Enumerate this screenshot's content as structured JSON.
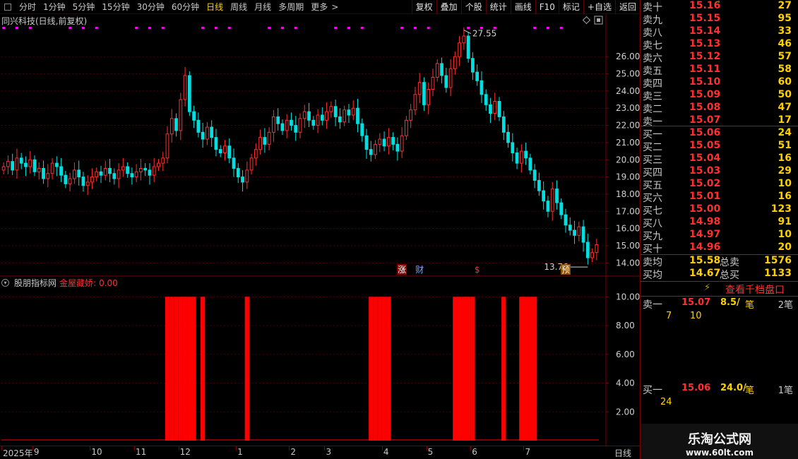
{
  "toolbar": {
    "periods": [
      "分时",
      "1分钟",
      "5分钟",
      "15分钟",
      "30分钟",
      "60分钟",
      "日线",
      "周线",
      "月线",
      "多周期",
      "更多"
    ],
    "active_period": "日线",
    "more_chevron": ">",
    "buttons": [
      "复权",
      "叠加",
      "个股",
      "统计",
      "画线",
      "F10",
      "标记",
      "+自选",
      "返回"
    ]
  },
  "main_chart": {
    "title": "同兴科技(日线,前复权)",
    "high_marker": "27.55",
    "low_marker": "13.76",
    "event_marks": [
      {
        "text": "涨",
        "bg": "#8a0000",
        "fg": "#ffffff",
        "x_day": 90
      },
      {
        "text": "财",
        "bg": "#000000",
        "fg": "#7aa6ff",
        "x_day": 94
      },
      {
        "text": "$",
        "bg": "#000000",
        "fg": "#ff3030",
        "x_day": 107
      },
      {
        "text": "预",
        "bg": "#8a5000",
        "fg": "#ffffff",
        "x_day": 127
      }
    ]
  },
  "indicator": {
    "name": "股朋指标网",
    "line_label": "金屋藏娇:",
    "line_value": "0.00"
  },
  "date_axis": {
    "labels": [
      {
        "text": "2025年",
        "day": 0
      },
      {
        "text": "9",
        "day": 7
      },
      {
        "text": "10",
        "day": 20
      },
      {
        "text": "11",
        "day": 30
      },
      {
        "text": "12",
        "day": 40
      },
      {
        "text": "1",
        "day": 53
      },
      {
        "text": "2",
        "day": 65
      },
      {
        "text": "3",
        "day": 73
      },
      {
        "text": "4",
        "day": 86
      },
      {
        "text": "5",
        "day": 96
      },
      {
        "text": "6",
        "day": 106
      },
      {
        "text": "7",
        "day": 118
      }
    ],
    "period_label": "日线"
  },
  "order_book": {
    "asks": [
      {
        "label": "卖十",
        "price": "15.16",
        "vol": "27",
        "mark": "*"
      },
      {
        "label": "卖九",
        "price": "15.15",
        "vol": "95",
        "mark": ""
      },
      {
        "label": "卖八",
        "price": "15.14",
        "vol": "33",
        "mark": ""
      },
      {
        "label": "卖七",
        "price": "15.13",
        "vol": "46",
        "mark": ""
      },
      {
        "label": "卖六",
        "price": "15.12",
        "vol": "57",
        "mark": ""
      },
      {
        "label": "卖五",
        "price": "15.11",
        "vol": "58",
        "mark": ""
      },
      {
        "label": "卖四",
        "price": "15.10",
        "vol": "60",
        "mark": ""
      },
      {
        "label": "卖三",
        "price": "15.09",
        "vol": "50",
        "mark": ""
      },
      {
        "label": "卖二",
        "price": "15.08",
        "vol": "47",
        "mark": ""
      },
      {
        "label": "卖一",
        "price": "15.07",
        "vol": "17",
        "mark": ""
      }
    ],
    "bids": [
      {
        "label": "买一",
        "price": "15.06",
        "vol": "24",
        "mark": ""
      },
      {
        "label": "买二",
        "price": "15.05",
        "vol": "51",
        "mark": ""
      },
      {
        "label": "买三",
        "price": "15.04",
        "vol": "16",
        "mark": ""
      },
      {
        "label": "买四",
        "price": "15.03",
        "vol": "29",
        "mark": ""
      },
      {
        "label": "买五",
        "price": "15.02",
        "vol": "10",
        "mark": ""
      },
      {
        "label": "买六",
        "price": "15.01",
        "vol": "16",
        "mark": ""
      },
      {
        "label": "买七",
        "price": "15.00",
        "vol": "123",
        "mark": ""
      },
      {
        "label": "买八",
        "price": "14.98",
        "vol": "91",
        "mark": ""
      },
      {
        "label": "买九",
        "price": "14.97",
        "vol": "10",
        "mark": ""
      },
      {
        "label": "买十",
        "price": "14.96",
        "vol": "20",
        "mark": "*"
      }
    ],
    "ask_avg_label": "卖均",
    "ask_avg": "15.58",
    "ask_total_label": "总卖",
    "ask_total": "1576",
    "bid_avg_label": "买均",
    "bid_avg": "14.67",
    "bid_total_label": "总买",
    "bid_total": "1133",
    "depth_button": "查看千档盘口",
    "ask1_tick": {
      "label": "卖一",
      "price": "15.07",
      "per": "8.5/",
      "unit": "笔",
      "count": "2笔",
      "q1": "7",
      "q2": "10"
    },
    "bid1_tick": {
      "label": "买一",
      "price": "15.06",
      "per": "24.0/",
      "unit": "笔",
      "count": "1笔",
      "q1": "24"
    }
  },
  "brand": {
    "name": "乐淘公式网",
    "url": "www.60lt.com"
  },
  "colors": {
    "up": "#ff3030",
    "down": "#00e0e0",
    "grid": "#7a0000",
    "signal": "#ff0000",
    "marker": "#ff00ff"
  },
  "chart_data": {
    "type": "candlestick",
    "title": "同兴科技(日线,前复权)",
    "y_ticks": [
      14,
      15,
      16,
      17,
      18,
      19,
      20,
      21,
      22,
      23,
      24,
      25,
      26
    ],
    "ylim": [
      13.6,
      27.9
    ],
    "high": 27.55,
    "low": 13.76,
    "closes": [
      19.6,
      19.9,
      19.4,
      20.1,
      19.8,
      19.6,
      20.0,
      19.3,
      19.5,
      18.9,
      19.2,
      19.8,
      19.6,
      19.1,
      18.6,
      18.9,
      19.4,
      19.0,
      18.5,
      18.7,
      19.0,
      19.3,
      19.1,
      19.5,
      19.2,
      18.9,
      19.4,
      19.6,
      19.2,
      19.0,
      19.3,
      19.5,
      19.4,
      19.1,
      19.6,
      19.8,
      20.1,
      21.5,
      22.4,
      21.7,
      23.5,
      24.9,
      22.8,
      22.3,
      21.6,
      21.2,
      21.9,
      21.3,
      20.6,
      20.4,
      20.8,
      20.1,
      19.5,
      19.0,
      18.7,
      19.4,
      20.1,
      20.6,
      21.3,
      20.9,
      21.6,
      22.5,
      22.1,
      21.7,
      22.3,
      22.0,
      21.6,
      22.4,
      22.8,
      22.3,
      22.0,
      22.6,
      22.3,
      22.8,
      23.1,
      22.5,
      22.2,
      22.9,
      22.6,
      23.0,
      22.1,
      21.4,
      20.6,
      20.3,
      20.9,
      21.2,
      20.8,
      21.3,
      20.9,
      20.5,
      21.4,
      22.3,
      22.9,
      23.8,
      24.5,
      23.2,
      24.1,
      24.8,
      25.6,
      24.9,
      24.2,
      25.3,
      26.0,
      26.8,
      27.2,
      25.9,
      25.1,
      24.6,
      23.8,
      23.2,
      22.7,
      23.4,
      22.5,
      21.6,
      21.0,
      20.4,
      19.8,
      20.5,
      20.1,
      19.4,
      18.8,
      18.2,
      17.6,
      17.0,
      18.3,
      17.5,
      16.8,
      16.2,
      15.9,
      15.6,
      16.1,
      15.2,
      14.3,
      14.6,
      15.06
    ],
    "indicator_name": "金屋藏娇",
    "indicator_yticks": [
      2,
      4,
      6,
      8,
      10
    ],
    "indicator_ylim": [
      0,
      10.8
    ],
    "indicator_signal_days": [
      37,
      38,
      39,
      40,
      41,
      42,
      43,
      45,
      55,
      83,
      84,
      85,
      86,
      87,
      102,
      103,
      104,
      105,
      106,
      113,
      117,
      118,
      119,
      120
    ]
  }
}
